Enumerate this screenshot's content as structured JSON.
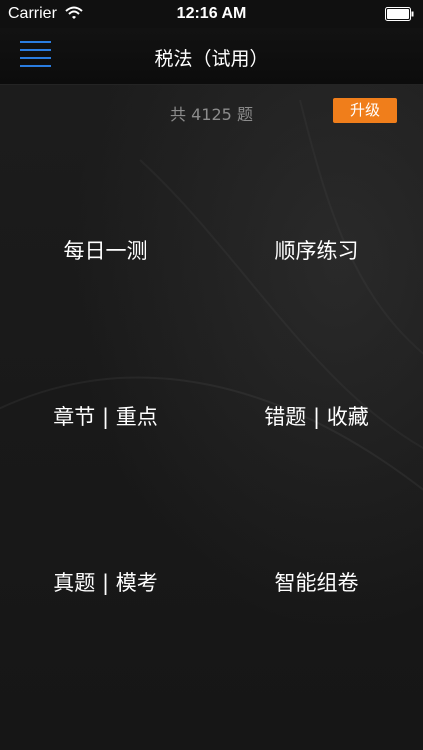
{
  "status_bar": {
    "carrier": "Carrier",
    "time": "12:16 AM",
    "wifi_icon": "wifi-icon",
    "battery_icon": "battery-icon"
  },
  "nav": {
    "title": "税法（试用）",
    "menu_icon": "hamburger-menu-icon",
    "accent_color": "#2a7de1"
  },
  "info": {
    "count_text": "共 4125 题",
    "upgrade_label": "升级",
    "upgrade_color": "#f07e1b"
  },
  "menu": {
    "items": [
      {
        "label": "每日一测"
      },
      {
        "label": "顺序练习"
      },
      {
        "label": "章节 | 重点"
      },
      {
        "label": "错题 | 收藏"
      },
      {
        "label": "真题 | 模考"
      },
      {
        "label": "智能组卷"
      }
    ]
  }
}
